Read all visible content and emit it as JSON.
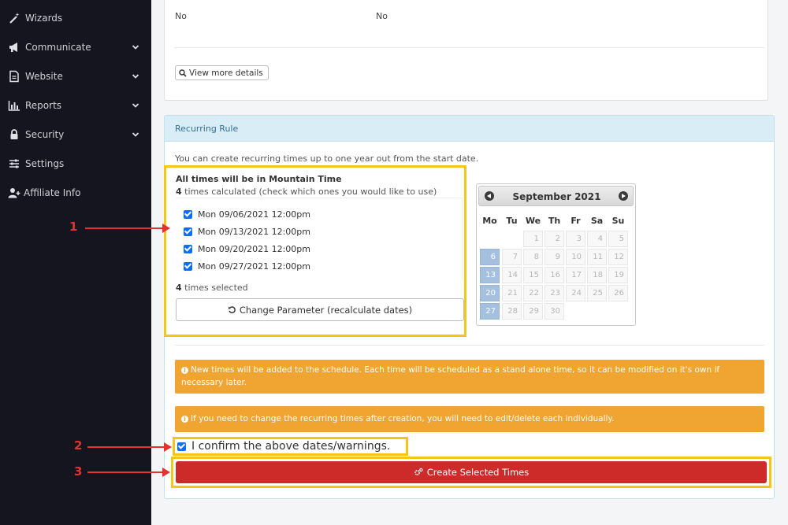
{
  "sidebar": {
    "items": [
      {
        "label": "Wizards",
        "icon": "magic-wand-icon",
        "has_chevron": false
      },
      {
        "label": "Communicate",
        "icon": "megaphone-icon",
        "has_chevron": true
      },
      {
        "label": "Website",
        "icon": "file-icon",
        "has_chevron": true
      },
      {
        "label": "Reports",
        "icon": "bar-chart-icon",
        "has_chevron": true
      },
      {
        "label": "Security",
        "icon": "lock-icon",
        "has_chevron": true
      },
      {
        "label": "Settings",
        "icon": "sliders-icon",
        "has_chevron": false
      },
      {
        "label": "Affiliate Info",
        "icon": "user-plus-icon",
        "has_chevron": false
      }
    ]
  },
  "top_card": {
    "value_left": "No",
    "value_right": "No",
    "view_more_label": "View more details"
  },
  "recurring": {
    "title": "Recurring Rule",
    "intro": "You can create recurring times up to one year out from the start date.",
    "timezone_note": "All times will be in Mountain Time",
    "calculated_count": "4",
    "calculated_suffix": " times calculated (check which ones you would like to use)",
    "times": [
      {
        "label": "Mon 09/06/2021 12:00pm",
        "checked": true
      },
      {
        "label": "Mon 09/13/2021 12:00pm",
        "checked": true
      },
      {
        "label": "Mon 09/20/2021 12:00pm",
        "checked": true
      },
      {
        "label": "Mon 09/27/2021 12:00pm",
        "checked": true
      }
    ],
    "selected_count": "4",
    "selected_suffix": " times selected",
    "recalc_label": "Change Parameter (recalculate dates)"
  },
  "calendar": {
    "title": "September 2021",
    "weekdays": [
      "Mo",
      "Tu",
      "We",
      "Th",
      "Fr",
      "Sa",
      "Su"
    ],
    "first_weekday_index": 2,
    "days_in_month": 30,
    "selected_days": [
      6,
      13,
      20,
      27
    ]
  },
  "alerts": {
    "new_times": "New times will be added to the schedule. Each time will be scheduled as a stand alone time, so it can be modified on it's own if necessary later.",
    "edit_each": "If you need to change the recurring times after creation, you will need to edit/delete each individually."
  },
  "confirm": {
    "label": "I confirm the above dates/warnings.",
    "checked": true
  },
  "create_button": {
    "label": "Create Selected Times"
  },
  "annotations": [
    "1",
    "2",
    "3"
  ],
  "colors": {
    "sidebar_bg": "#15151f",
    "panel_head": "#d9edf7",
    "alert": "#f0a431",
    "create_button": "#cd2a2a",
    "highlight": "#f5c518",
    "annotation": "#e5322f",
    "calendar_selected": "#a5c0de"
  }
}
